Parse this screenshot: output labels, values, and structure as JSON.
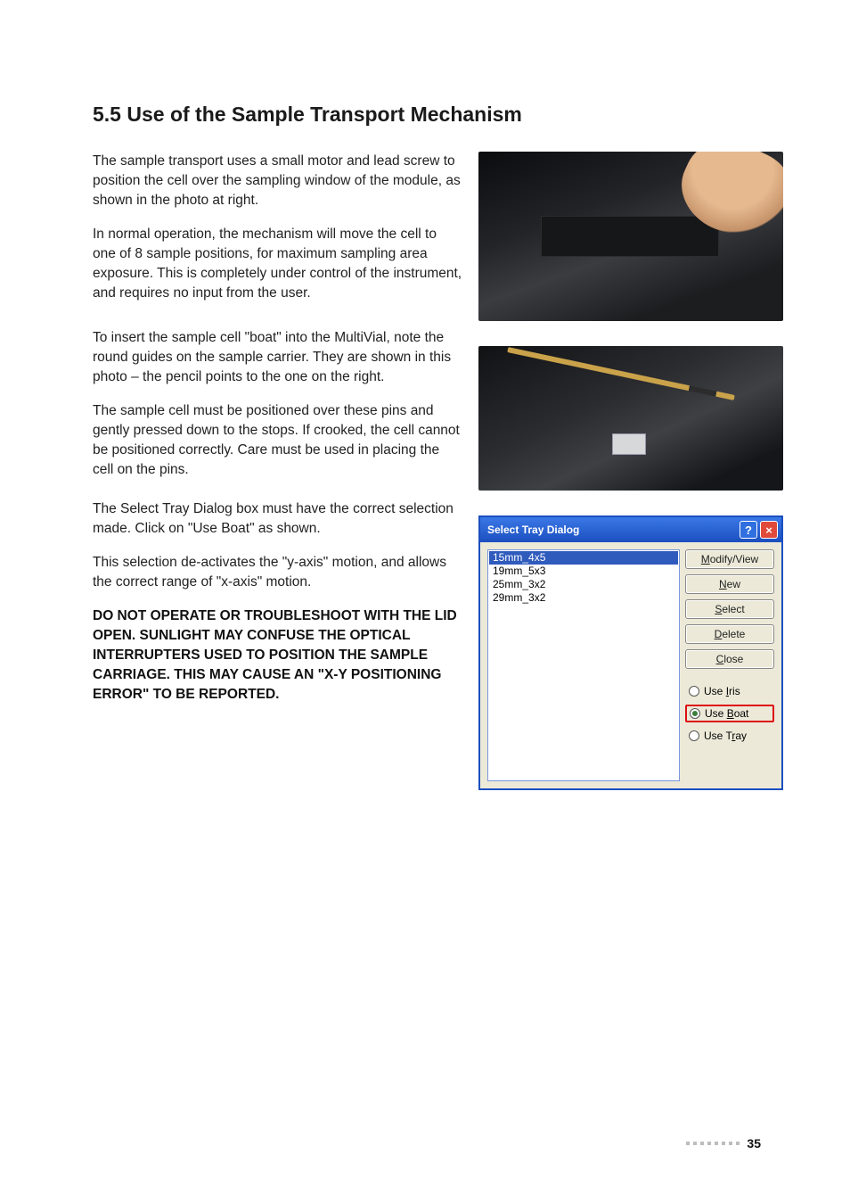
{
  "heading": "5.5   Use of the Sample Transport Mechanism",
  "paragraphs": {
    "p1": "The sample transport uses a small motor and lead screw to position the cell over the sampling window of the module, as shown in the photo at right.",
    "p2": "In normal operation, the mechanism will move the cell to one of 8 sample positions, for maximum sampling area exposure. This is completely under control of the instrument, and requires no input from the user.",
    "p3": "To insert the sample cell \"boat\" into the MultiVial, note the round guides on the sample carrier. They are shown in this photo – the pencil points to the one on the right.",
    "p4": "The sample cell must be positioned over these pins and gently pressed down to the stops. If crooked, the cell cannot be positioned correctly. Care must be used in placing the cell on the pins.",
    "p5": "The Select Tray Dialog box must have the correct selection made. Click on \"Use Boat\" as shown.",
    "p6": "This selection de-activates the \"y-axis\" motion, and allows the correct range of \"x-axis\" motion.",
    "warn": "DO NOT OPERATE OR TROUBLESHOOT WITH THE LID OPEN. SUNLIGHT MAY CONFUSE THE OPTICAL INTERRUPTERS USED TO POSITION THE SAMPLE CARRIAGE. THIS MAY CAUSE AN \"X-Y POSITIONING ERROR\" TO BE REPORTED."
  },
  "dialog": {
    "title": "Select Tray Dialog",
    "list": [
      "15mm_4x5",
      "19mm_5x3",
      "25mm_3x2",
      "29mm_3x2"
    ],
    "selected_index": 0,
    "buttons": {
      "modify": "Modify/View",
      "new": "New",
      "select": "Select",
      "delete": "Delete",
      "close": "Close"
    },
    "radios": {
      "iris": "Use Iris",
      "boat": "Use Boat",
      "tray": "Use Tray",
      "selected": "boat"
    }
  },
  "page_number": "35"
}
